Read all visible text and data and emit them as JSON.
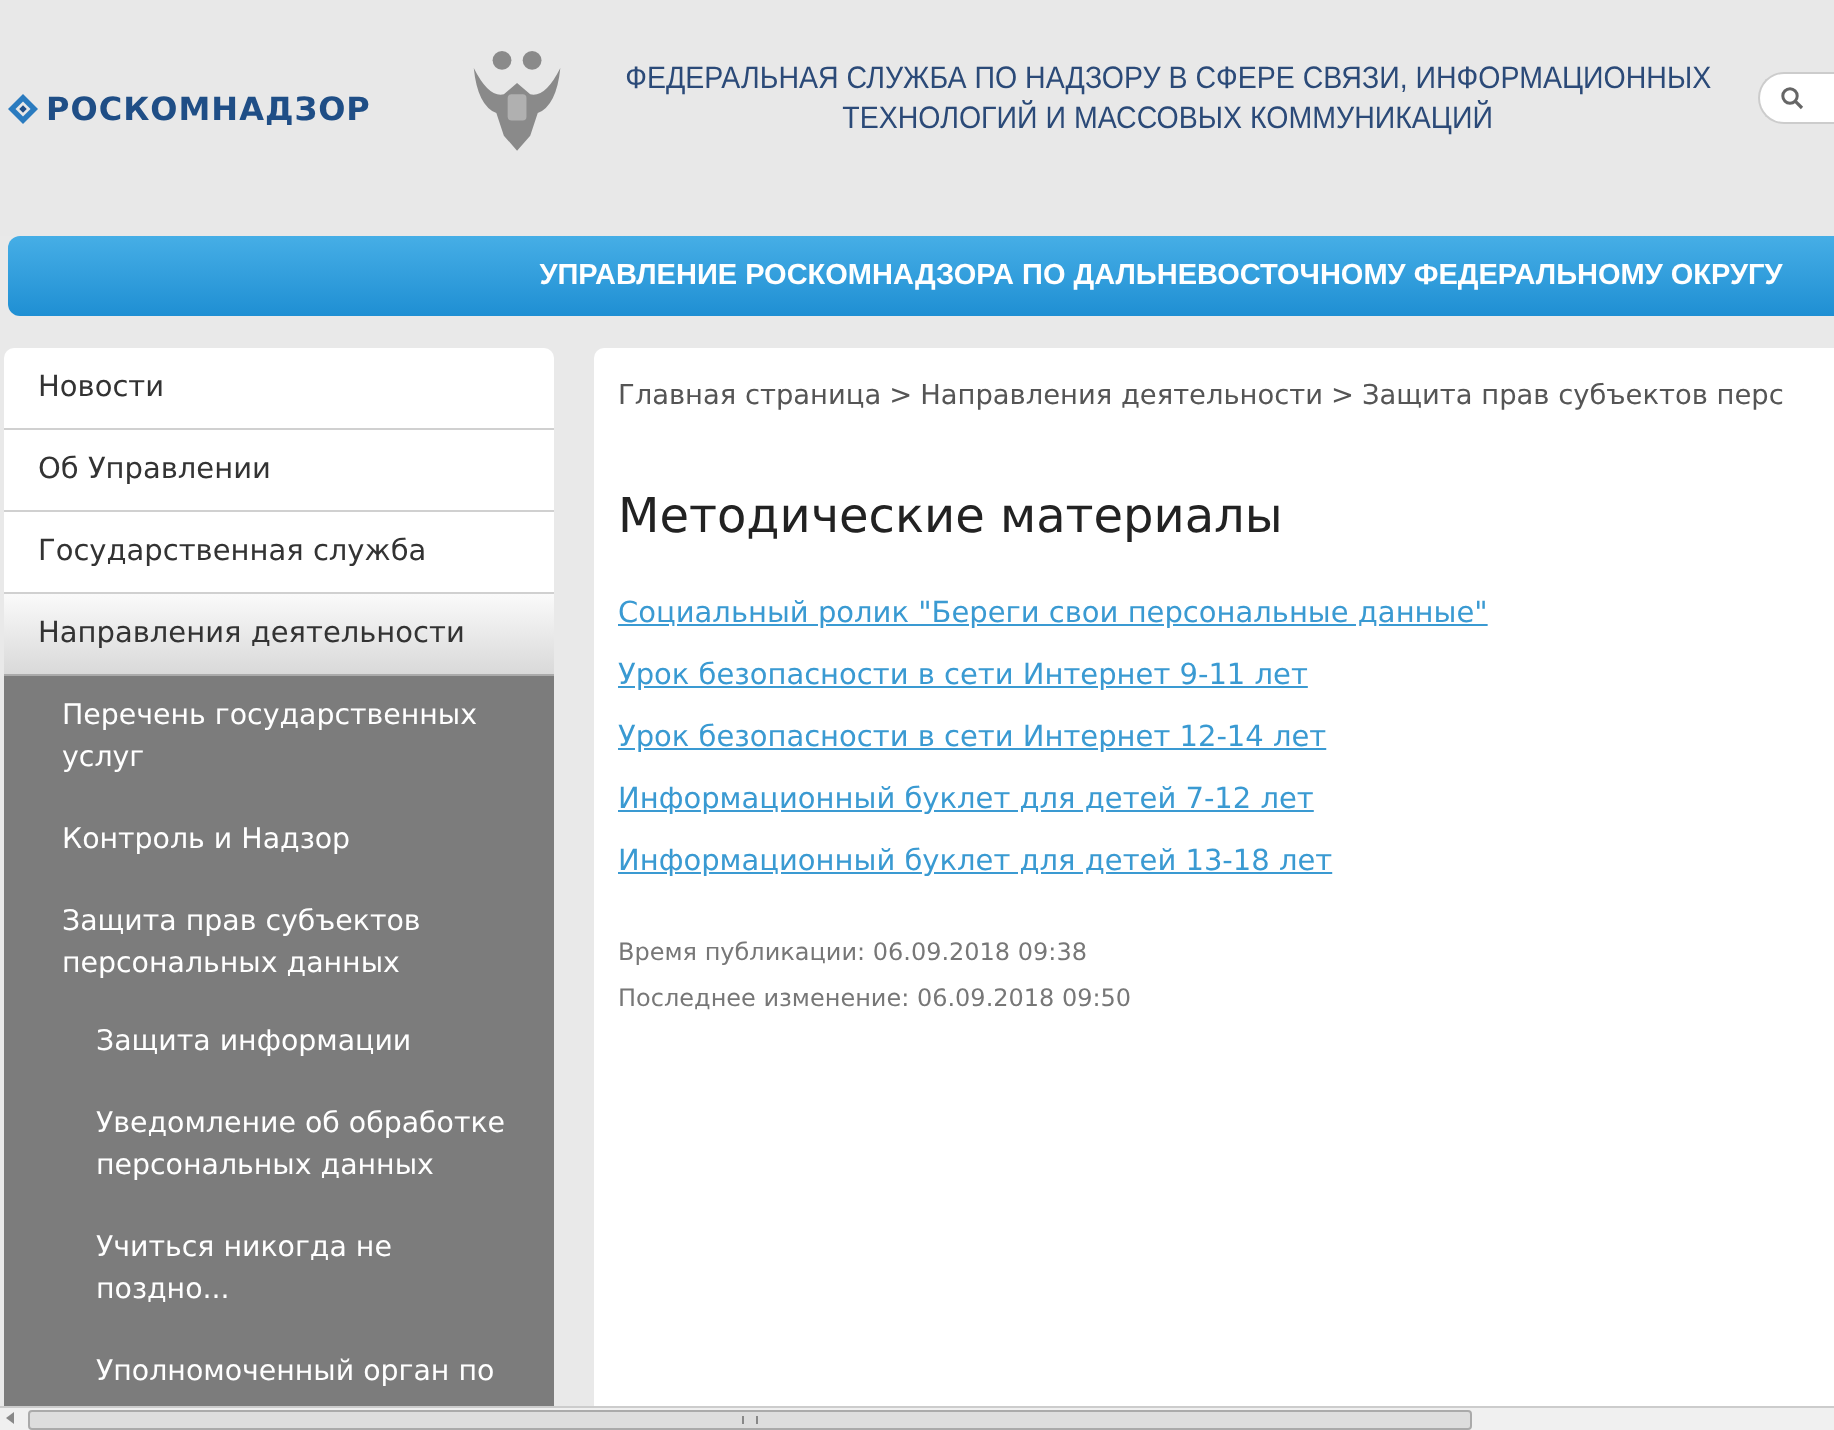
{
  "header": {
    "logo": "РОСКОМНАДЗОР",
    "title_lines": [
      "ФЕДЕРАЛЬНАЯ СЛУЖБА ПО НАДЗОРУ В СФЕРЕ СВЯЗИ, ИНФОРМАЦИОННЫХ",
      "ТЕХНОЛОГИЙ И МАССОВЫХ КОММУНИКАЦИЙ"
    ]
  },
  "banner": "УПРАВЛЕНИЕ РОСКОМНАДЗОРА ПО ДАЛЬНЕВОСТОЧНОМУ ФЕДЕРАЛЬНОМУ ОКРУГУ",
  "sidebar": {
    "items": [
      {
        "label": "Новости",
        "selected": false,
        "expanded": false
      },
      {
        "label": "Об Управлении",
        "selected": false,
        "expanded": false
      },
      {
        "label": "Государственная служба",
        "selected": false,
        "expanded": false
      },
      {
        "label": "Направления деятельности",
        "selected": true,
        "expanded": true,
        "children": [
          {
            "label": "Перечень государственных услуг"
          },
          {
            "label": "Контроль и Надзор"
          },
          {
            "label": "Защита прав субъектов персональных данных",
            "children": [
              {
                "label": "Защита информации"
              },
              {
                "label": "Уведомление об обработке персональных данных"
              },
              {
                "label": "Учиться никогда не поздно..."
              },
              {
                "label": "Уполномоченный орган по"
              }
            ]
          }
        ]
      }
    ]
  },
  "breadcrumbs": [
    "Главная страница",
    "Направления деятельности",
    "Защита прав субъектов перс"
  ],
  "breadcrumb_separator": ">",
  "heading": "Методические материалы",
  "links": [
    "Социальный ролик \"Береги свои персональные данные\"",
    "Урок безопасности в сети Интернет 9-11 лет",
    "Урок безопасности в сети Интернет 12-14 лет",
    "Информационный буклет для детей 7-12 лет",
    "Информационный буклет для детей 13-18 лет"
  ],
  "meta": [
    "Время публикации: 06.09.2018 09:38",
    "Последнее изменение: 06.09.2018 09:50"
  ]
}
